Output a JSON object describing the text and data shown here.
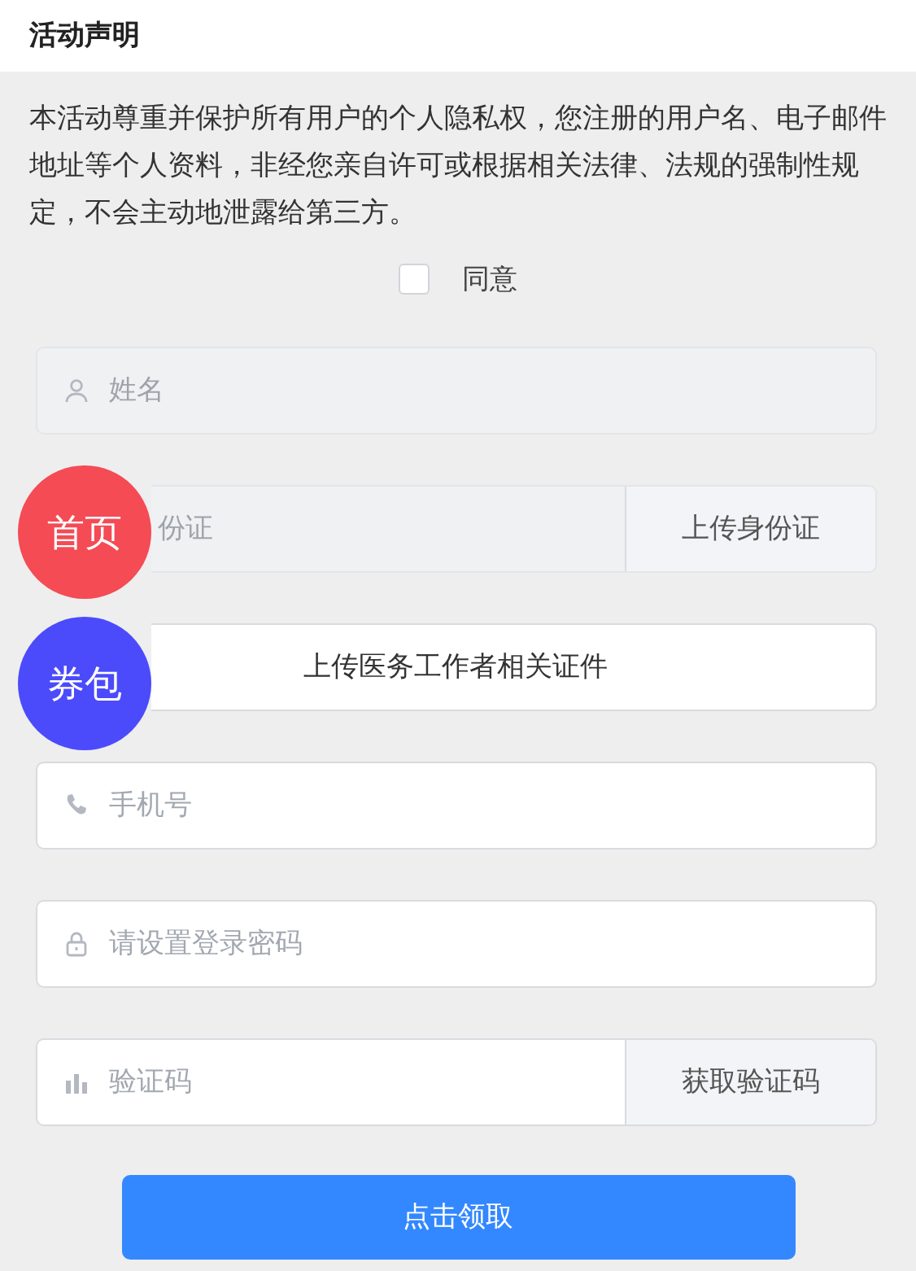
{
  "header": {
    "title": "活动声明"
  },
  "statement": "本活动尊重并保护所有用户的个人隐私权，您注册的用户名、电子邮件地址等个人资料，非经您亲自许可或根据相关法律、法规的强制性规定，不会主动地泄露给第三方。",
  "agree": {
    "label": "同意",
    "checked": false
  },
  "fields": [
    {
      "kind": "name",
      "placeholder": "姓名",
      "disabled": true
    },
    {
      "kind": "id",
      "placeholder": "份证",
      "button": "上传身份证",
      "disabled": true
    },
    {
      "kind": "upload",
      "label": "上传医务工作者相关证件"
    },
    {
      "kind": "phone",
      "placeholder": "手机号",
      "disabled": false
    },
    {
      "kind": "password",
      "placeholder": "请设置登录密码",
      "disabled": false
    },
    {
      "kind": "code",
      "placeholder": "验证码",
      "button": "获取验证码",
      "disabled": false
    }
  ],
  "submit": "点击领取",
  "floating": [
    {
      "label": "首页",
      "color": "#f44b55"
    },
    {
      "label": "券包",
      "color": "#4b4bfb"
    }
  ]
}
